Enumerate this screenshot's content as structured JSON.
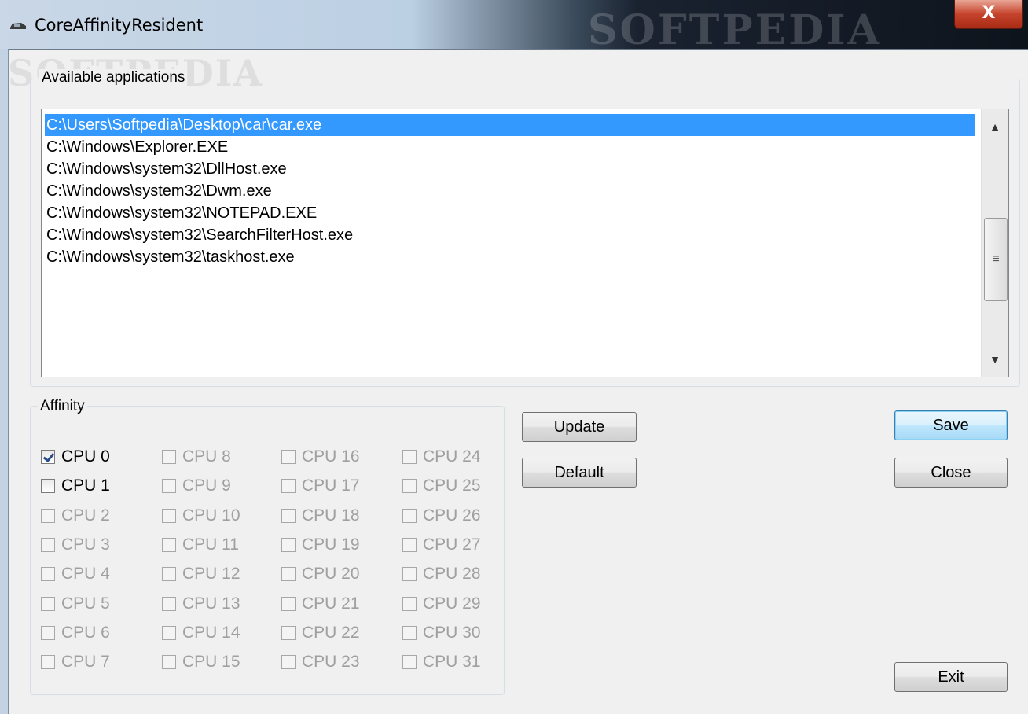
{
  "window": {
    "title": "CoreAffinityResident",
    "close_label": "X",
    "watermark": "SOFTPEDIA"
  },
  "applications": {
    "group_label": "Available applications",
    "items": [
      "C:\\Users\\Softpedia\\Desktop\\car\\car.exe",
      "C:\\Windows\\Explorer.EXE",
      "C:\\Windows\\system32\\DllHost.exe",
      "C:\\Windows\\system32\\Dwm.exe",
      "C:\\Windows\\system32\\NOTEPAD.EXE",
      "C:\\Windows\\system32\\SearchFilterHost.exe",
      "C:\\Windows\\system32\\taskhost.exe"
    ],
    "selected_index": 0
  },
  "affinity": {
    "group_label": "Affinity",
    "cpus": [
      {
        "label": "CPU 0",
        "checked": true,
        "enabled": true
      },
      {
        "label": "CPU 1",
        "checked": false,
        "enabled": true
      },
      {
        "label": "CPU 2",
        "checked": false,
        "enabled": false
      },
      {
        "label": "CPU 3",
        "checked": false,
        "enabled": false
      },
      {
        "label": "CPU 4",
        "checked": false,
        "enabled": false
      },
      {
        "label": "CPU 5",
        "checked": false,
        "enabled": false
      },
      {
        "label": "CPU 6",
        "checked": false,
        "enabled": false
      },
      {
        "label": "CPU 7",
        "checked": false,
        "enabled": false
      },
      {
        "label": "CPU 8",
        "checked": false,
        "enabled": false
      },
      {
        "label": "CPU 9",
        "checked": false,
        "enabled": false
      },
      {
        "label": "CPU 10",
        "checked": false,
        "enabled": false
      },
      {
        "label": "CPU 11",
        "checked": false,
        "enabled": false
      },
      {
        "label": "CPU 12",
        "checked": false,
        "enabled": false
      },
      {
        "label": "CPU 13",
        "checked": false,
        "enabled": false
      },
      {
        "label": "CPU 14",
        "checked": false,
        "enabled": false
      },
      {
        "label": "CPU 15",
        "checked": false,
        "enabled": false
      },
      {
        "label": "CPU 16",
        "checked": false,
        "enabled": false
      },
      {
        "label": "CPU 17",
        "checked": false,
        "enabled": false
      },
      {
        "label": "CPU 18",
        "checked": false,
        "enabled": false
      },
      {
        "label": "CPU 19",
        "checked": false,
        "enabled": false
      },
      {
        "label": "CPU 20",
        "checked": false,
        "enabled": false
      },
      {
        "label": "CPU 21",
        "checked": false,
        "enabled": false
      },
      {
        "label": "CPU 22",
        "checked": false,
        "enabled": false
      },
      {
        "label": "CPU 23",
        "checked": false,
        "enabled": false
      },
      {
        "label": "CPU 24",
        "checked": false,
        "enabled": false
      },
      {
        "label": "CPU 25",
        "checked": false,
        "enabled": false
      },
      {
        "label": "CPU 26",
        "checked": false,
        "enabled": false
      },
      {
        "label": "CPU 27",
        "checked": false,
        "enabled": false
      },
      {
        "label": "CPU 28",
        "checked": false,
        "enabled": false
      },
      {
        "label": "CPU 29",
        "checked": false,
        "enabled": false
      },
      {
        "label": "CPU 30",
        "checked": false,
        "enabled": false
      },
      {
        "label": "CPU 31",
        "checked": false,
        "enabled": false
      }
    ]
  },
  "buttons": {
    "update": "Update",
    "default": "Default",
    "save": "Save",
    "close": "Close",
    "exit": "Exit"
  },
  "colors": {
    "selection": "#3399ff",
    "window_bg": "#f0f0f0",
    "close_button": "#c5432c"
  },
  "icons": {
    "app": "car-icon",
    "close": "close-icon",
    "scroll_up": "arrow-up-icon",
    "scroll_down": "arrow-down-icon",
    "scroll_thumb": "grip-icon"
  }
}
